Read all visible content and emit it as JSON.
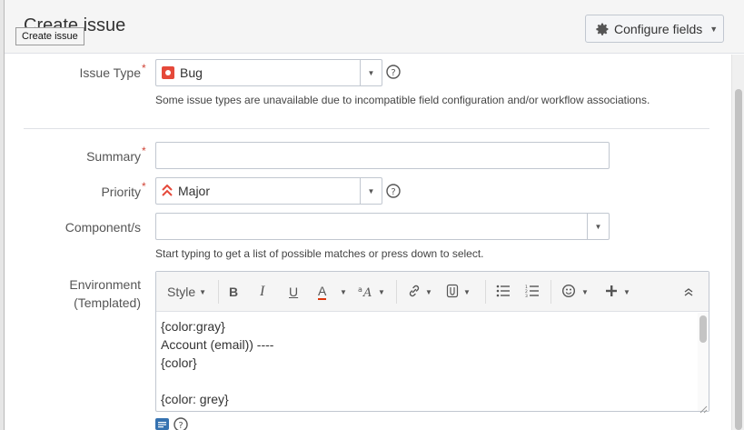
{
  "dialog": {
    "title": "Create issue",
    "tooltip": "Create issue",
    "configure_fields_label": "Configure fields"
  },
  "fields": {
    "issue_type": {
      "label": "Issue Type",
      "value": "Bug",
      "hint": "Some issue types are unavailable due to incompatible field configuration and/or workflow associations.",
      "icon": "bug-icon",
      "icon_color": "#e5493a"
    },
    "summary": {
      "label": "Summary",
      "value": ""
    },
    "priority": {
      "label": "Priority",
      "value": "Major",
      "icon": "priority-major-icon",
      "icon_color": "#e5493a"
    },
    "components": {
      "label": "Component/s",
      "value": "",
      "hint": "Start typing to get a list of possible matches or press down to select."
    },
    "environment": {
      "label_line1": "Environment",
      "label_line2": "(Templated)",
      "toolbar": {
        "style_label": "Style",
        "bold": "B",
        "italic": "I",
        "underline": "U",
        "text_color": "A",
        "text_color_accent": "#de350b"
      },
      "lines": [
        "{color:gray}",
        "Account (email)) ----",
        "{color}",
        "",
        "{color: grey}"
      ]
    }
  },
  "required_marker": "*",
  "colors": {
    "required": "#d04437",
    "wiki_icon": "#3572b0"
  }
}
